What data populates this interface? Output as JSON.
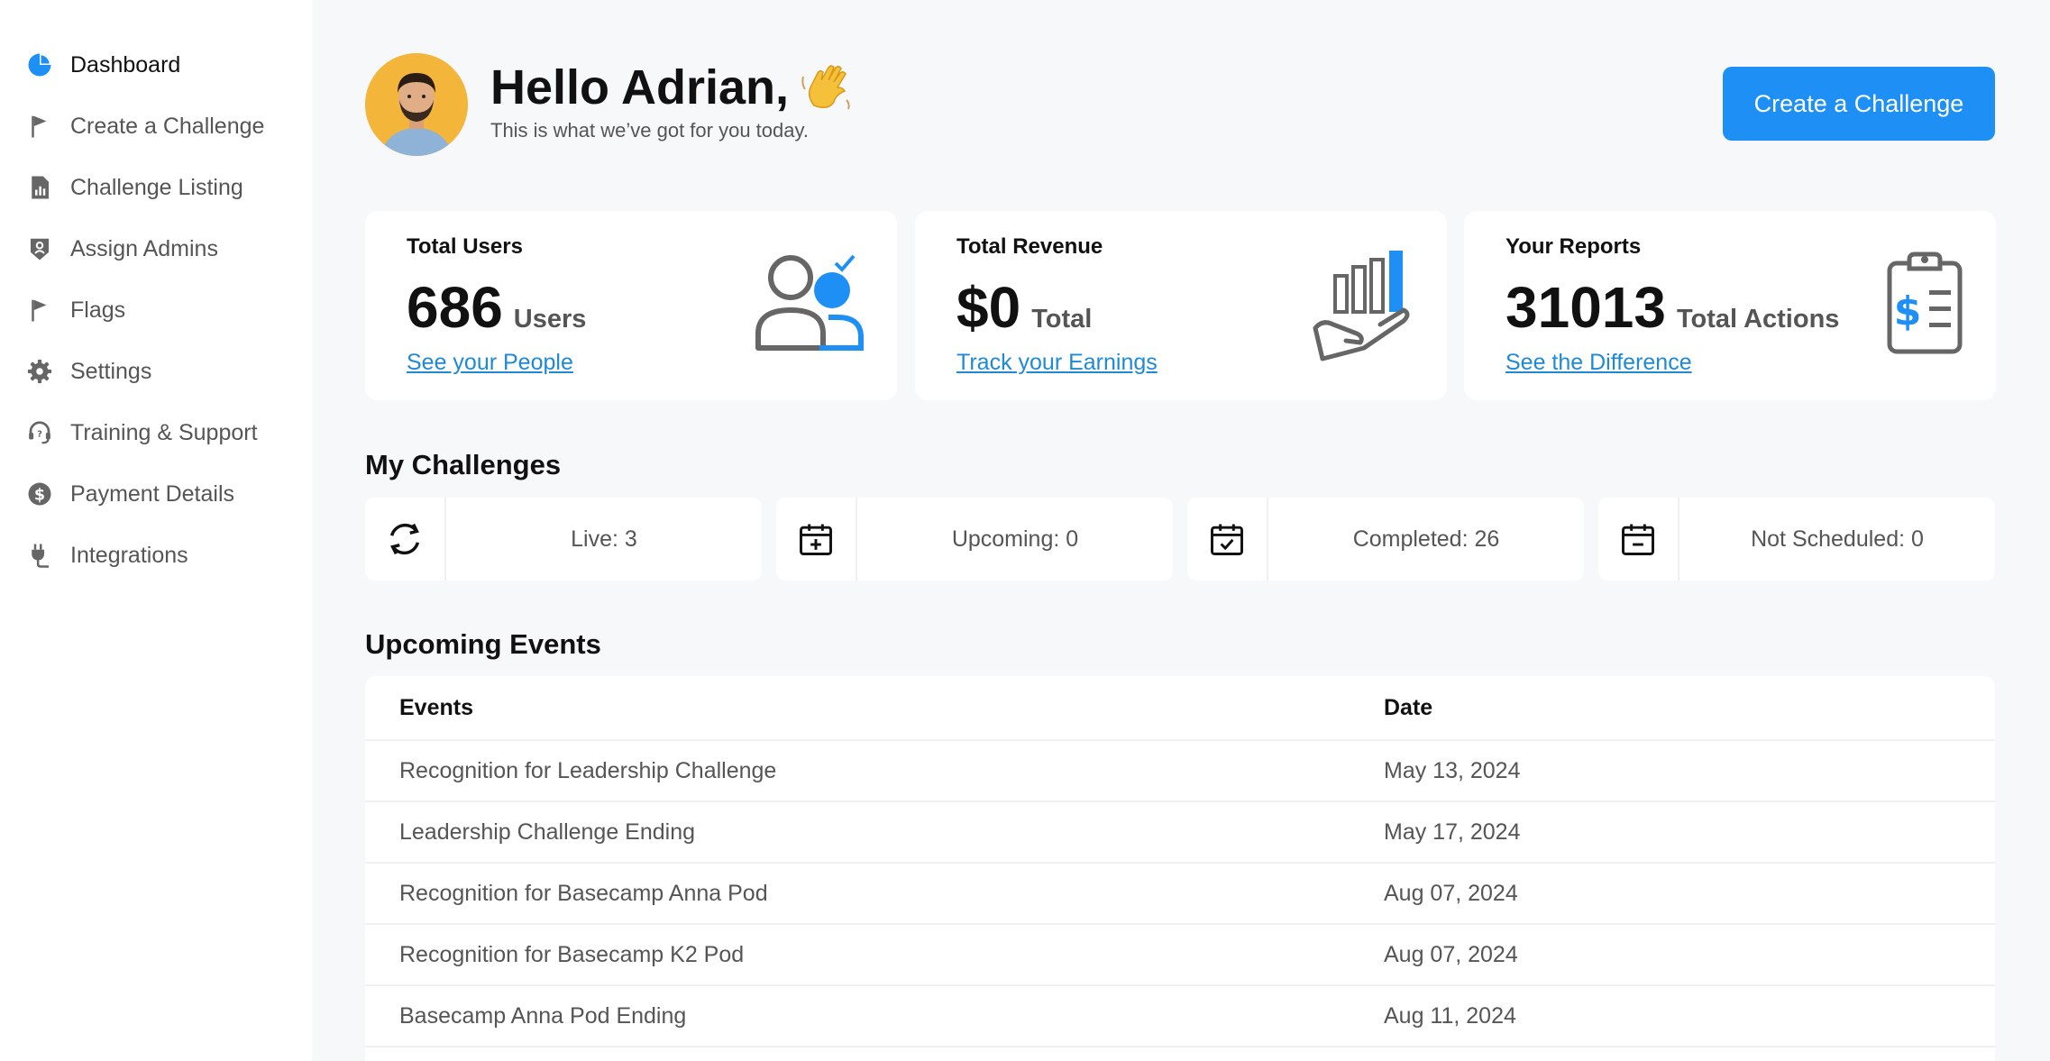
{
  "sidebar": {
    "items": [
      {
        "label": "Dashboard",
        "icon": "pie-chart-icon",
        "active": true
      },
      {
        "label": "Create a Challenge",
        "icon": "flag-icon"
      },
      {
        "label": "Challenge Listing",
        "icon": "report-icon"
      },
      {
        "label": "Assign Admins",
        "icon": "admin-badge-icon"
      },
      {
        "label": "Flags",
        "icon": "flag-icon"
      },
      {
        "label": "Settings",
        "icon": "gear-icon"
      },
      {
        "label": "Training & Support",
        "icon": "headset-icon"
      },
      {
        "label": "Payment Details",
        "icon": "dollar-icon"
      },
      {
        "label": "Integrations",
        "icon": "plug-icon"
      }
    ]
  },
  "header": {
    "greeting": "Hello Adrian,",
    "subtitle": "This is what we’ve got for you today.",
    "create_button": "Create a Challenge"
  },
  "stats": [
    {
      "title": "Total Users",
      "value": "686",
      "unit": "Users",
      "link": "See your People",
      "icon": "users-icon"
    },
    {
      "title": "Total Revenue",
      "value": "$0",
      "unit": "Total",
      "link": "Track your Earnings",
      "icon": "revenue-hand-icon"
    },
    {
      "title": "Your Reports",
      "value": "31013",
      "unit": "Total Actions",
      "link": "See the Difference",
      "icon": "clipboard-dollar-icon"
    }
  ],
  "challenges": {
    "title": "My Challenges",
    "items": [
      {
        "label": "Live: 3",
        "icon": "refresh-icon"
      },
      {
        "label": "Upcoming: 0",
        "icon": "calendar-plus-icon"
      },
      {
        "label": "Completed: 26",
        "icon": "calendar-check-icon"
      },
      {
        "label": "Not Scheduled: 0",
        "icon": "calendar-minus-icon"
      }
    ]
  },
  "events": {
    "title": "Upcoming Events",
    "columns": [
      "Events",
      "Date"
    ],
    "rows": [
      {
        "event": "Recognition for Leadership Challenge",
        "date": "May 13, 2024"
      },
      {
        "event": "Leadership Challenge Ending",
        "date": "May 17, 2024"
      },
      {
        "event": "Recognition for Basecamp Anna Pod",
        "date": "Aug 07, 2024"
      },
      {
        "event": "Recognition for Basecamp K2 Pod",
        "date": "Aug 07, 2024"
      },
      {
        "event": "Basecamp Anna Pod Ending",
        "date": "Aug 11, 2024"
      }
    ]
  },
  "colors": {
    "accent": "#1e90f5",
    "link": "#1e8ad6",
    "avatar_bg": "#f4b63a"
  }
}
